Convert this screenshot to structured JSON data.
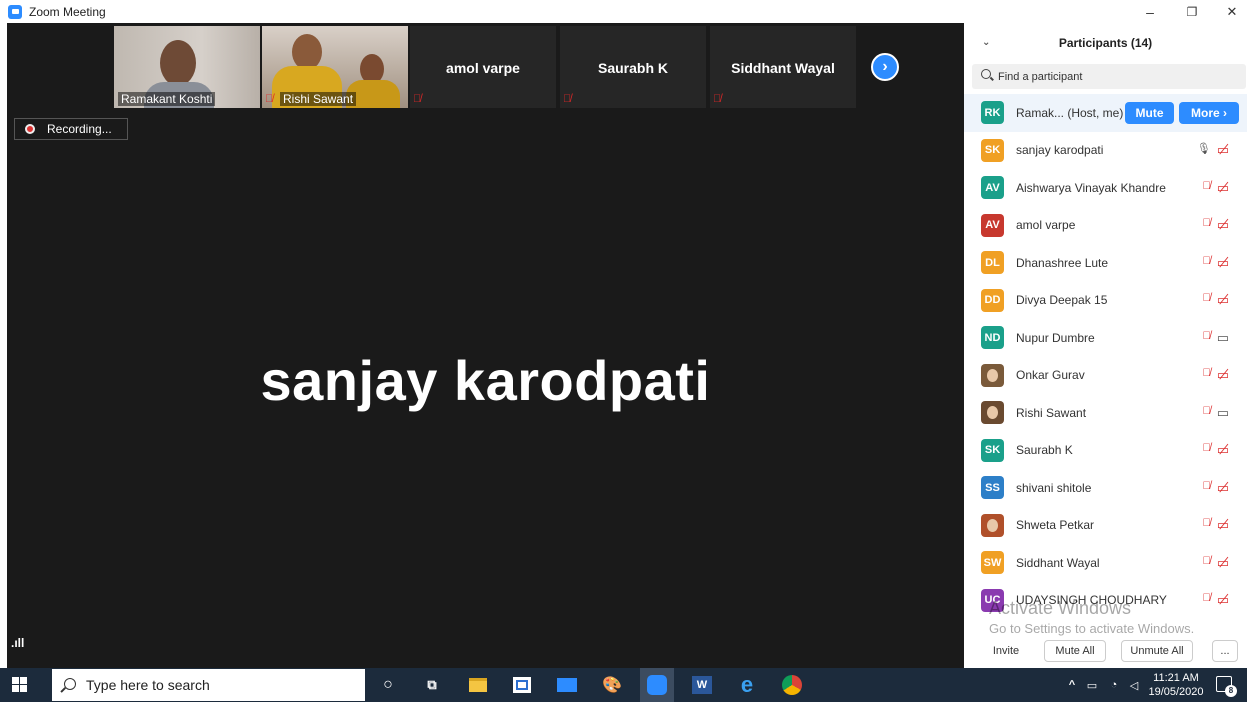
{
  "window": {
    "title": "Zoom Meeting",
    "minimize": "–",
    "restore": "❐",
    "close": "✕"
  },
  "meeting": {
    "thumbnails": [
      {
        "label": "Ramakant Koshti",
        "has_video": true
      },
      {
        "label": "Rishi Sawant",
        "has_video": true
      },
      {
        "name": "amol varpe",
        "has_video": false
      },
      {
        "name": "Saurabh K",
        "has_video": false
      },
      {
        "name": "Siddhant Wayal",
        "has_video": false
      }
    ],
    "next_glyph": "›",
    "recording_label": "Recording...",
    "active_speaker": "sanjay karodpati",
    "signal_glyph": ".ıll"
  },
  "participants": {
    "title": "Participants (14)",
    "collapse_glyph": "⌄",
    "search_placeholder": "Find a participant",
    "host": {
      "initials": "RK",
      "name": "Ramak... (Host, me)",
      "color": "#1aa08a",
      "mute_label": "Mute",
      "more_label": "More ›"
    },
    "rows": [
      {
        "initials": "SK",
        "name": "sanjay karodpati",
        "color": "#f0a024",
        "mic": "on",
        "video": "off"
      },
      {
        "initials": "AV",
        "name": "Aishwarya Vinayak Khandre",
        "color": "#1aa08a",
        "mic": "off",
        "video": "off"
      },
      {
        "initials": "AV",
        "name": "amol varpe",
        "color": "#c7382e",
        "mic": "off",
        "video": "off"
      },
      {
        "initials": "DL",
        "name": "Dhanashree Lute",
        "color": "#f0a024",
        "mic": "off",
        "video": "off"
      },
      {
        "initials": "DD",
        "name": "Divya Deepak 15",
        "color": "#f0a024",
        "mic": "off",
        "video": "off"
      },
      {
        "initials": "ND",
        "name": "Nupur Dumbre",
        "color": "#1aa08a",
        "mic": "off",
        "video": "on"
      },
      {
        "initials": "",
        "name": "Onkar Gurav",
        "color": "#7a5a3a",
        "mic": "off",
        "video": "off",
        "photo": true
      },
      {
        "initials": "",
        "name": "Rishi Sawant",
        "color": "#6a4a30",
        "mic": "off",
        "video": "on",
        "photo": true
      },
      {
        "initials": "SK",
        "name": "Saurabh K",
        "color": "#1aa08a",
        "mic": "off",
        "video": "off"
      },
      {
        "initials": "SS",
        "name": "shivani shitole",
        "color": "#2d7fc8",
        "mic": "off",
        "video": "off"
      },
      {
        "initials": "",
        "name": "Shweta Petkar",
        "color": "#b0502a",
        "mic": "off",
        "video": "off",
        "photo": true
      },
      {
        "initials": "SW",
        "name": "Siddhant Wayal",
        "color": "#f0a024",
        "mic": "off",
        "video": "off"
      },
      {
        "initials": "UC",
        "name": "UDAYSINGH CHOUDHARY",
        "color": "#8a3ab0",
        "mic": "off",
        "video": "off"
      }
    ],
    "watermark_title": "Activate Windows",
    "watermark_sub": "Go to Settings to activate Windows.",
    "footer": {
      "invite": "Invite",
      "mute_all": "Mute All",
      "unmute_all": "Unmute All",
      "more": "..."
    }
  },
  "taskbar": {
    "search_placeholder": "Type here to search",
    "time": "11:21 AM",
    "date": "19/05/2020",
    "notification_count": "8"
  },
  "colors": {
    "zoom_blue": "#2d8cff",
    "meeting_bg": "#1a1a1a",
    "taskbar_bg": "#1c2b3c",
    "muted_red": "#d33333"
  }
}
